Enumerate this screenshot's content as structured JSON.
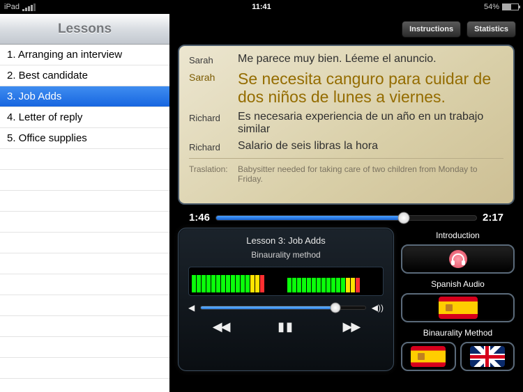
{
  "statusbar": {
    "time": "11:41",
    "battery_text": "54%"
  },
  "sidebar": {
    "title": "Lessons",
    "items": [
      {
        "label": "1. Arranging an interview",
        "selected": false
      },
      {
        "label": "2. Best candidate",
        "selected": false
      },
      {
        "label": "3. Job Adds",
        "selected": true
      },
      {
        "label": "4. Letter of reply",
        "selected": false
      },
      {
        "label": "5. Office supplies",
        "selected": false
      }
    ]
  },
  "topbar": {
    "instructions": "Instructions",
    "statistics": "Statistics"
  },
  "transcript": [
    {
      "speaker": "Sarah",
      "text": "Me parece muy bien. Léeme el anuncio.",
      "highlight": false
    },
    {
      "speaker": "Sarah",
      "text": "Se necesita canguro para cuidar de dos niños de lunes a viernes.",
      "highlight": true
    },
    {
      "speaker": "Richard",
      "text": "Es necesaria experiencia de un año en un trabajo similar",
      "highlight": false
    },
    {
      "speaker": "Richard",
      "text": "Salario de seis libras la hora",
      "highlight": false
    }
  ],
  "translation": {
    "label": "Traslation:",
    "text": "Babysitter needed for taking care of two children from Monday to Friday."
  },
  "progress": {
    "elapsed": "1:46",
    "total": "2:17"
  },
  "player": {
    "title": "Lesson 3: Job Adds",
    "subtitle": "Binaurality method"
  },
  "right": {
    "intro_label": "Introduction",
    "spanish_label": "Spanish Audio",
    "binaural_label": "Binaurality Method"
  }
}
